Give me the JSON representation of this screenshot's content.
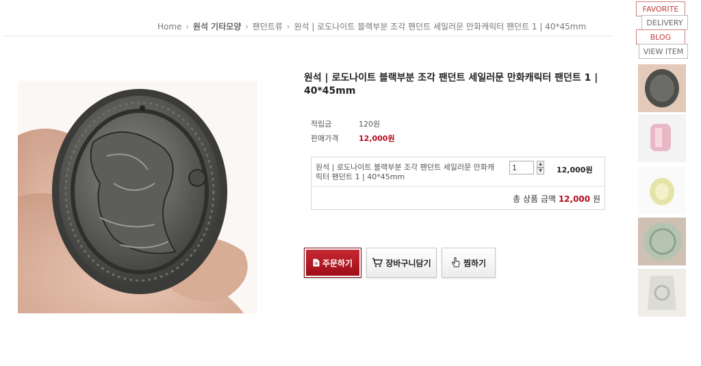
{
  "breadcrumb": {
    "home": "Home",
    "level1": "원석 기타모양",
    "level2": "팬던트류",
    "current": "원석 | 로도나이트 블랙부분 조각 팬던트 세일러문 만화캐릭터 팬던트 1 | 40*45mm"
  },
  "side_tabs": {
    "favorite": "FAVORITE",
    "delivery": "DELIVERY",
    "blog": "BLOG",
    "view_item": "VIEW ITEM"
  },
  "product": {
    "title": "원석 | 로도나이트 블랙부분 조각 팬던트 세일러문 만화캐릭터 팬던트 1 | 40*45mm",
    "points_label": "적립금",
    "points_value": "120원",
    "price_label": "판매가격",
    "price_value": "12,000원"
  },
  "option": {
    "name": "원석 | 로도나이트 블랙부분 조각 팬던트 세일러문 만화캐릭터 팬던트 1 | 40*45mm",
    "quantity": "1",
    "price": "12,000원",
    "total_label": "총 상품 금액",
    "total_amount": "12,000",
    "total_unit": "원"
  },
  "buttons": {
    "order": "주문하기",
    "cart": "장바구니담기",
    "wish": "찜하기"
  },
  "icons": {
    "order": "document-icon",
    "cart": "cart-icon",
    "wish": "hand-pointer-icon"
  },
  "colors": {
    "accent": "#b50c1d",
    "order_button": "#a8121d"
  }
}
